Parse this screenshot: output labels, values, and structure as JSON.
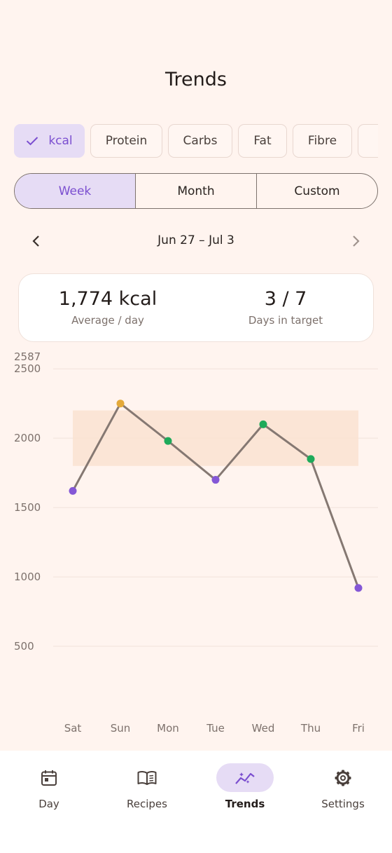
{
  "header": {
    "title": "Trends"
  },
  "metric_chips": [
    {
      "label": "kcal",
      "selected": true
    },
    {
      "label": "Protein",
      "selected": false
    },
    {
      "label": "Carbs",
      "selected": false
    },
    {
      "label": "Fat",
      "selected": false
    },
    {
      "label": "Fibre",
      "selected": false
    },
    {
      "label": "",
      "selected": false
    }
  ],
  "range_tabs": [
    {
      "label": "Week",
      "selected": true
    },
    {
      "label": "Month",
      "selected": false
    },
    {
      "label": "Custom",
      "selected": false
    }
  ],
  "date_nav": {
    "label": "Jun 27 – Jul 3",
    "prev_icon": "chevron-left-icon",
    "next_icon": "chevron-right-icon"
  },
  "summary": {
    "average_value": "1,774 kcal",
    "average_label": "Average / day",
    "days_value": "3 / 7",
    "days_label": "Days in target"
  },
  "chart_data": {
    "type": "line",
    "title": "",
    "xlabel": "",
    "ylabel": "",
    "categories": [
      "Sat",
      "Sun",
      "Mon",
      "Tue",
      "Wed",
      "Thu",
      "Fri"
    ],
    "series": [
      {
        "values": [
          1620,
          2250,
          1980,
          1700,
          2100,
          1850,
          920
        ]
      }
    ],
    "point_status": [
      "below",
      "above",
      "in",
      "below",
      "in",
      "in",
      "below"
    ],
    "target_range": [
      1800,
      2200
    ],
    "ylim": [
      0,
      2587
    ],
    "y_max_label": "2587",
    "yticks": [
      500,
      1000,
      1500,
      2000,
      2500
    ],
    "grid": true,
    "legend": "none"
  },
  "colors": {
    "accent": "#7b4fd0",
    "line": "#857872",
    "below": "#8457d6",
    "in_target": "#1eaa5a",
    "above": "#e3a93a",
    "target_band": "#fbe3d3",
    "background": "#fff4ef"
  },
  "bottom_nav": [
    {
      "label": "Day",
      "icon": "calendar-icon",
      "active": false
    },
    {
      "label": "Recipes",
      "icon": "book-icon",
      "active": false
    },
    {
      "label": "Trends",
      "icon": "trend-icon",
      "active": true
    },
    {
      "label": "Settings",
      "icon": "gear-icon",
      "active": false
    }
  ]
}
